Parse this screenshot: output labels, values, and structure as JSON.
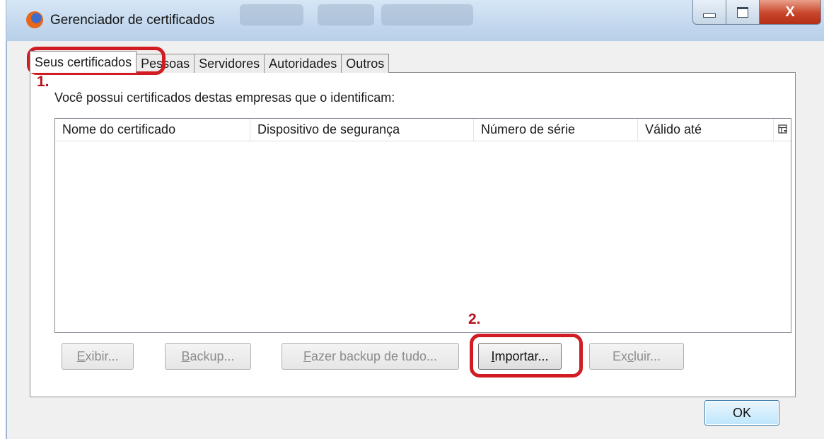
{
  "window": {
    "title": "Gerenciador de certificados",
    "close_glyph": "X"
  },
  "tabs": [
    {
      "label": "Seus certificados",
      "active": true
    },
    {
      "label": "Pessoas",
      "active": false
    },
    {
      "label": "Servidores",
      "active": false
    },
    {
      "label": "Autoridades",
      "active": false
    },
    {
      "label": "Outros",
      "active": false
    }
  ],
  "description": "Você possui certificados destas empresas que o identificam:",
  "table": {
    "columns": [
      "Nome do certificado",
      "Dispositivo de segurança",
      "Número de série",
      "Válido até"
    ],
    "rows": []
  },
  "buttons": {
    "view": {
      "pre": "",
      "accel": "E",
      "post": "xibir...",
      "enabled": false
    },
    "backup": {
      "pre": "",
      "accel": "B",
      "post": "ackup...",
      "enabled": false
    },
    "backup_all": {
      "pre": "",
      "accel": "F",
      "post": "azer backup de tudo...",
      "enabled": false
    },
    "import": {
      "pre": "",
      "accel": "I",
      "post": "mportar...",
      "enabled": true
    },
    "delete": {
      "pre": "Ex",
      "accel": "c",
      "post": "luir...",
      "enabled": false
    },
    "ok": "OK"
  },
  "annotations": {
    "step1": "1.",
    "step2": "2.",
    "highlight_color": "#d01c22"
  },
  "icons": [
    "firefox-icon",
    "minimize-icon",
    "maximize-icon",
    "close-icon",
    "column-picker-icon"
  ]
}
